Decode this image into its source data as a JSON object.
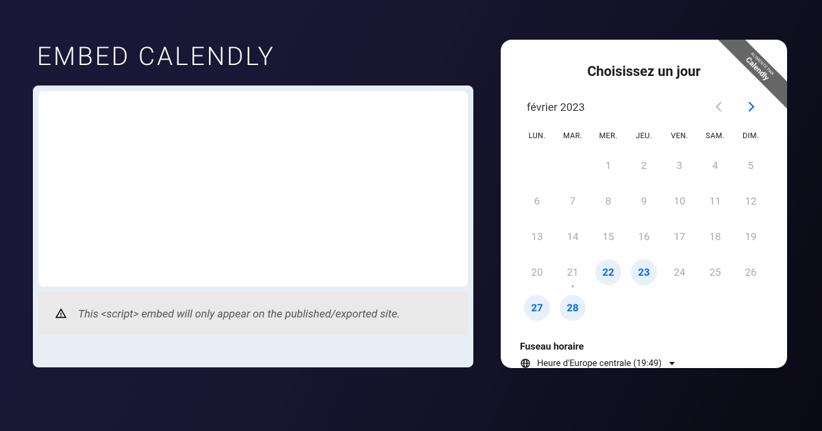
{
  "title": "EMBED CALENDLY",
  "warning": "This <script> embed will only appear on the published/exported site.",
  "ribbon": {
    "small": "ALIMENTÉ PAR",
    "brand": "Calendly"
  },
  "calendar": {
    "heading": "Choisissez un jour",
    "month": "février 2023",
    "day_headers": [
      "LUN.",
      "MAR.",
      "MER.",
      "JEU.",
      "VEN.",
      "SAM.",
      "DIM."
    ],
    "weeks": [
      [
        {
          "n": ""
        },
        {
          "n": ""
        },
        {
          "n": "1"
        },
        {
          "n": "2"
        },
        {
          "n": "3"
        },
        {
          "n": "4"
        },
        {
          "n": "5"
        }
      ],
      [
        {
          "n": "6"
        },
        {
          "n": "7"
        },
        {
          "n": "8"
        },
        {
          "n": "9"
        },
        {
          "n": "10"
        },
        {
          "n": "11"
        },
        {
          "n": "12"
        }
      ],
      [
        {
          "n": "13"
        },
        {
          "n": "14"
        },
        {
          "n": "15"
        },
        {
          "n": "16"
        },
        {
          "n": "17"
        },
        {
          "n": "18"
        },
        {
          "n": "19"
        }
      ],
      [
        {
          "n": "20"
        },
        {
          "n": "21",
          "dot": true
        },
        {
          "n": "22",
          "available": true
        },
        {
          "n": "23",
          "available": true
        },
        {
          "n": "24"
        },
        {
          "n": "25"
        },
        {
          "n": "26"
        }
      ],
      [
        {
          "n": "27",
          "available": true
        },
        {
          "n": "28",
          "available": true
        },
        {
          "n": ""
        },
        {
          "n": ""
        },
        {
          "n": ""
        },
        {
          "n": ""
        },
        {
          "n": ""
        }
      ]
    ],
    "timezone": {
      "label": "Fuseau horaire",
      "value": "Heure d'Europe centrale (19:49)"
    }
  }
}
